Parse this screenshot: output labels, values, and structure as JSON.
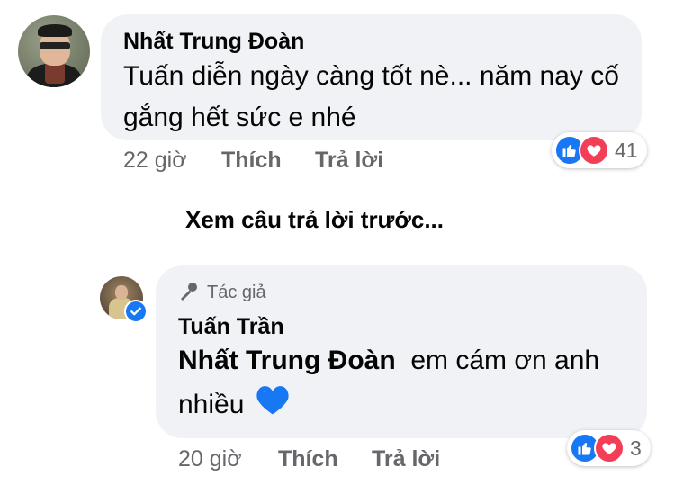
{
  "comments": [
    {
      "author": "Nhất Trung Đoàn",
      "text": "Tuấn diễn ngày càng tốt nè... năm nay cố gắng hết sức e nhé",
      "time": "22 giờ",
      "like_label": "Thích",
      "reply_label": "Trả lời",
      "reaction_count": "41"
    }
  ],
  "see_previous": "Xem câu trả lời trước...",
  "reply": {
    "author_badge": "Tác giả",
    "author": "Tuấn Trần",
    "mention": "Nhất Trung Đoàn",
    "text_line1": "em cám ơn anh",
    "text_line2": "nhiều",
    "emoji": "💙",
    "time": "20 giờ",
    "like_label": "Thích",
    "reply_label": "Trả lời",
    "reaction_count": "3"
  },
  "colors": {
    "bubble_bg": "#f0f2f5",
    "like_blue": "#1877f2",
    "love_red": "#f33e58",
    "meta_gray": "#65676b"
  }
}
